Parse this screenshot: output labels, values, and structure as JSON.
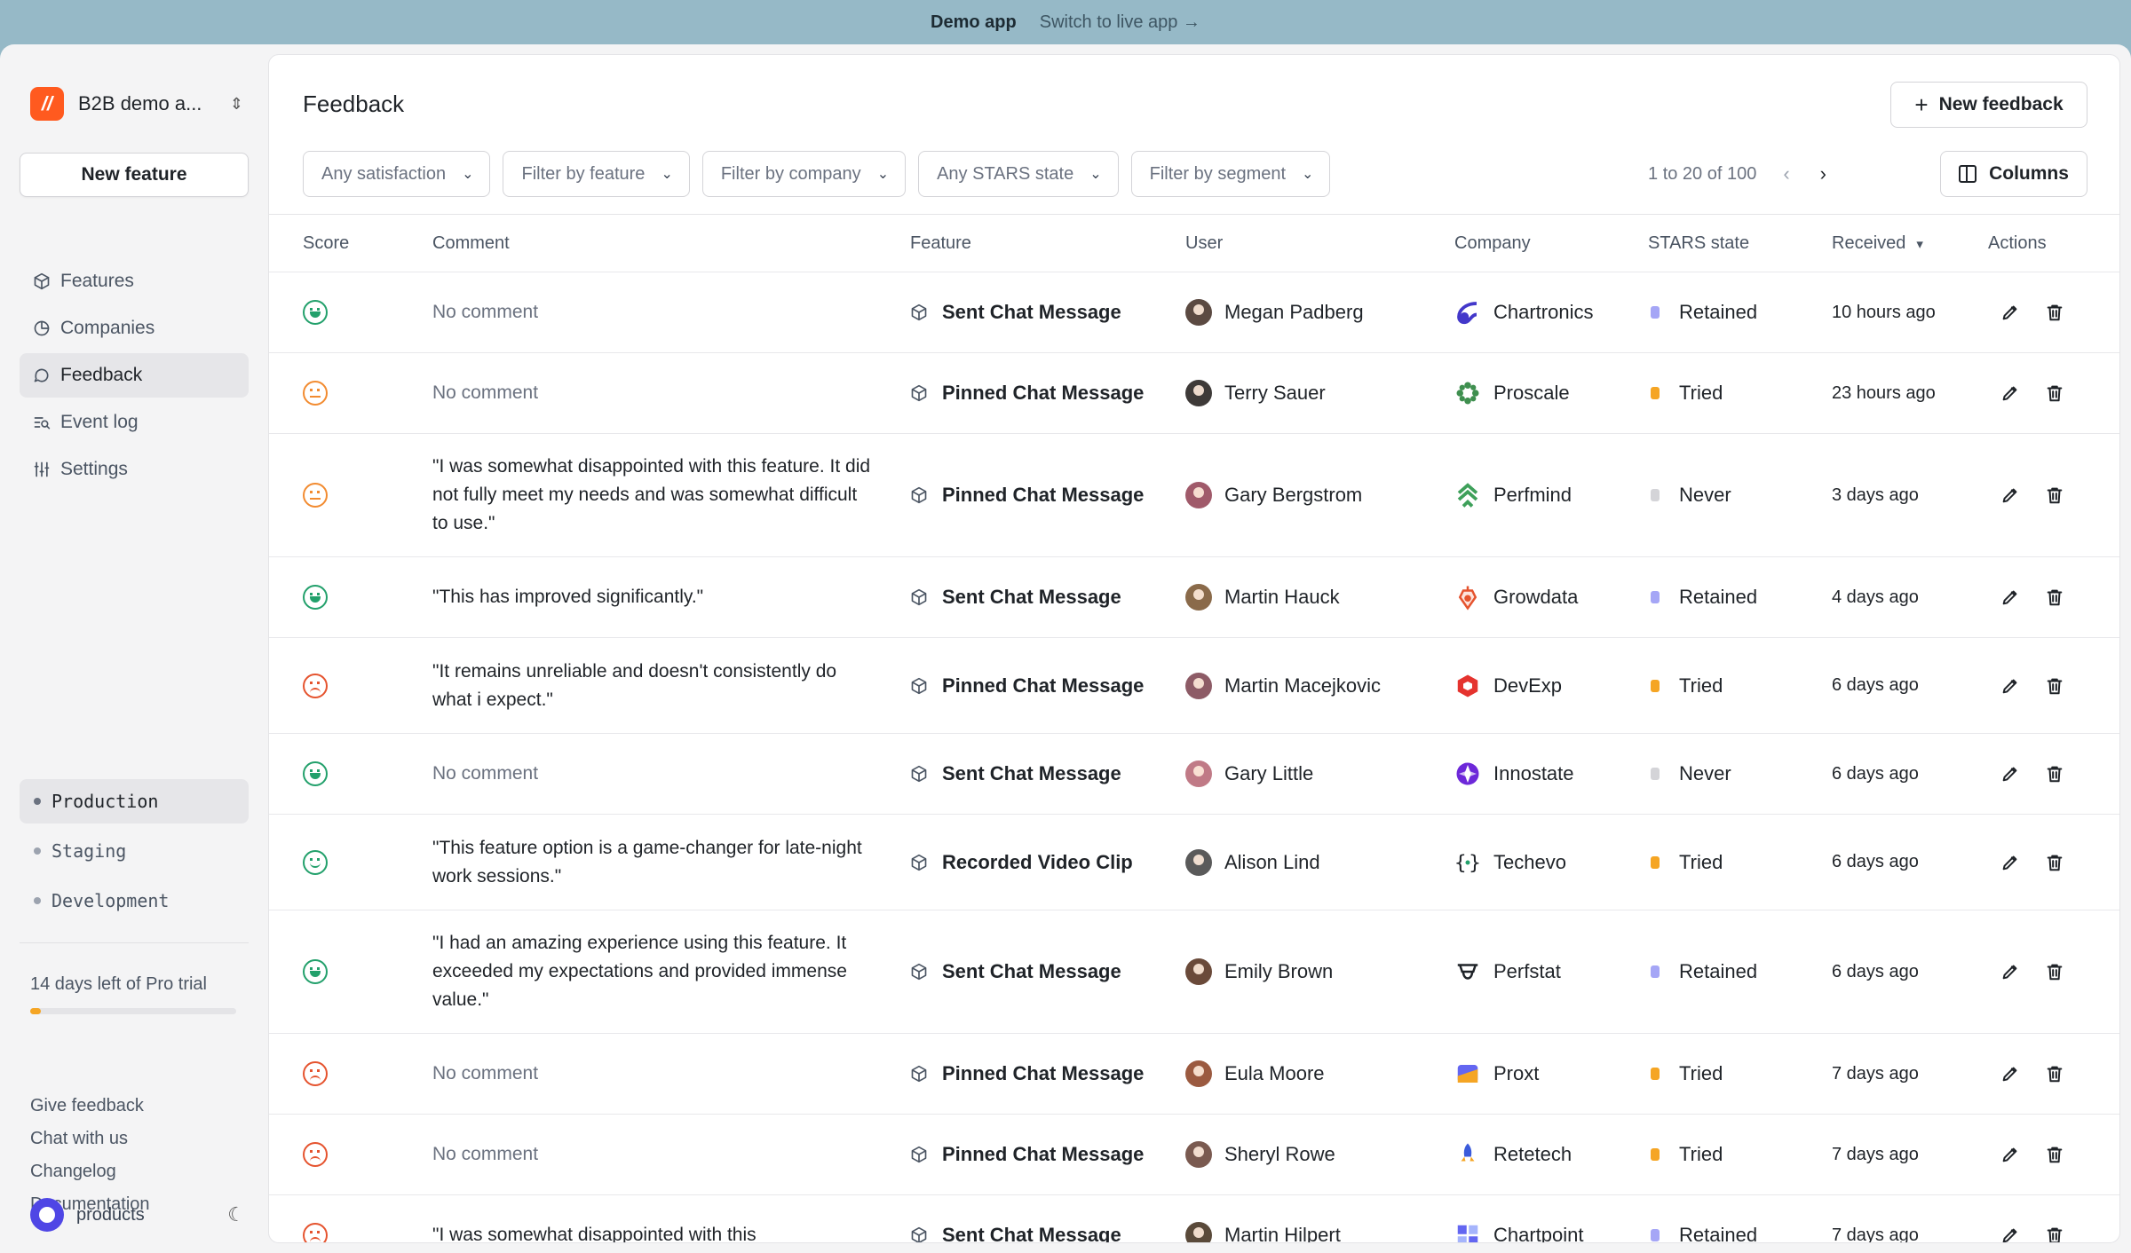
{
  "banner": {
    "title": "Demo app",
    "link": "Switch to live app →"
  },
  "sidebar": {
    "org_name": "B2B demo a...",
    "new_feature": "New feature",
    "nav": [
      {
        "label": "Features",
        "icon": "cube-icon"
      },
      {
        "label": "Companies",
        "icon": "pie-chart-icon"
      },
      {
        "label": "Feedback",
        "icon": "chat-bubble-icon",
        "active": true
      },
      {
        "label": "Event log",
        "icon": "list-search-icon"
      },
      {
        "label": "Settings",
        "icon": "sliders-icon"
      }
    ],
    "environments": [
      "Production",
      "Staging",
      "Development"
    ],
    "trial_text": "14 days left of Pro trial",
    "trial_progress": 0.05,
    "links": [
      "Give feedback",
      "Chat with us",
      "Changelog",
      "Documentation"
    ],
    "user": "products"
  },
  "main": {
    "title": "Feedback",
    "new_feedback": "New feedback",
    "filters": [
      "Any satisfaction",
      "Filter by feature",
      "Filter by company",
      "Any STARS state",
      "Filter by segment"
    ],
    "pager": "1 to 20 of 100",
    "columns_btn": "Columns",
    "headers": {
      "score": "Score",
      "comment": "Comment",
      "feature": "Feature",
      "user": "User",
      "company": "Company",
      "stars": "STARS state",
      "received": "Received",
      "actions": "Actions"
    },
    "rows": [
      {
        "score": "very-satisfied",
        "comment": "No comment",
        "feature": "Sent Chat Message",
        "user": "Megan Padberg",
        "company": "Chartronics",
        "stars": "Retained",
        "received": "10 hours ago"
      },
      {
        "score": "neutral",
        "comment": "No comment",
        "feature": "Pinned Chat Message",
        "user": "Terry Sauer",
        "company": "Proscale",
        "stars": "Tried",
        "received": "23 hours ago"
      },
      {
        "score": "neutral",
        "comment": "\"I was somewhat disappointed with this feature. It did not fully meet my needs and was somewhat difficult to use.\"",
        "feature": "Pinned Chat Message",
        "user": "Gary Bergstrom",
        "company": "Perfmind",
        "stars": "Never",
        "received": "3 days ago"
      },
      {
        "score": "very-satisfied",
        "comment": "\"This has improved significantly.\"",
        "feature": "Sent Chat Message",
        "user": "Martin Hauck",
        "company": "Growdata",
        "stars": "Retained",
        "received": "4 days ago"
      },
      {
        "score": "dissatisfied",
        "comment": "\"It remains unreliable and doesn't consistently do what i expect.\"",
        "feature": "Pinned Chat Message",
        "user": "Martin Macejkovic",
        "company": "DevExp",
        "stars": "Tried",
        "received": "6 days ago"
      },
      {
        "score": "very-satisfied",
        "comment": "No comment",
        "feature": "Sent Chat Message",
        "user": "Gary Little",
        "company": "Innostate",
        "stars": "Never",
        "received": "6 days ago"
      },
      {
        "score": "satisfied",
        "comment": "\"This feature option is a game-changer for late-night work sessions.\"",
        "feature": "Recorded Video Clip",
        "user": "Alison Lind",
        "company": "Techevo",
        "stars": "Tried",
        "received": "6 days ago"
      },
      {
        "score": "very-satisfied",
        "comment": "\"I had an amazing experience using this feature. It exceeded my expectations and provided immense value.\"",
        "feature": "Sent Chat Message",
        "user": "Emily Brown",
        "company": "Perfstat",
        "stars": "Retained",
        "received": "6 days ago"
      },
      {
        "score": "dissatisfied",
        "comment": "No comment",
        "feature": "Pinned Chat Message",
        "user": "Eula Moore",
        "company": "Proxt",
        "stars": "Tried",
        "received": "7 days ago"
      },
      {
        "score": "dissatisfied",
        "comment": "No comment",
        "feature": "Pinned Chat Message",
        "user": "Sheryl Rowe",
        "company": "Retetech",
        "stars": "Tried",
        "received": "7 days ago"
      },
      {
        "score": "dissatisfied",
        "comment": "\"I was somewhat disappointed with this",
        "feature": "Sent Chat Message",
        "user": "Martin Hilpert",
        "company": "Chartpoint",
        "stars": "Retained",
        "received": "7 days ago"
      }
    ]
  },
  "colors": {
    "banner_bg": "#96b9c7",
    "brand": "#ff5a1f",
    "score_happy": "#22a06b",
    "score_neutral": "#f28b30",
    "score_sad": "#e5532e",
    "stars_retained": "#a5a6f6",
    "stars_tried": "#f5a524",
    "stars_never": "#d4d4d8"
  }
}
